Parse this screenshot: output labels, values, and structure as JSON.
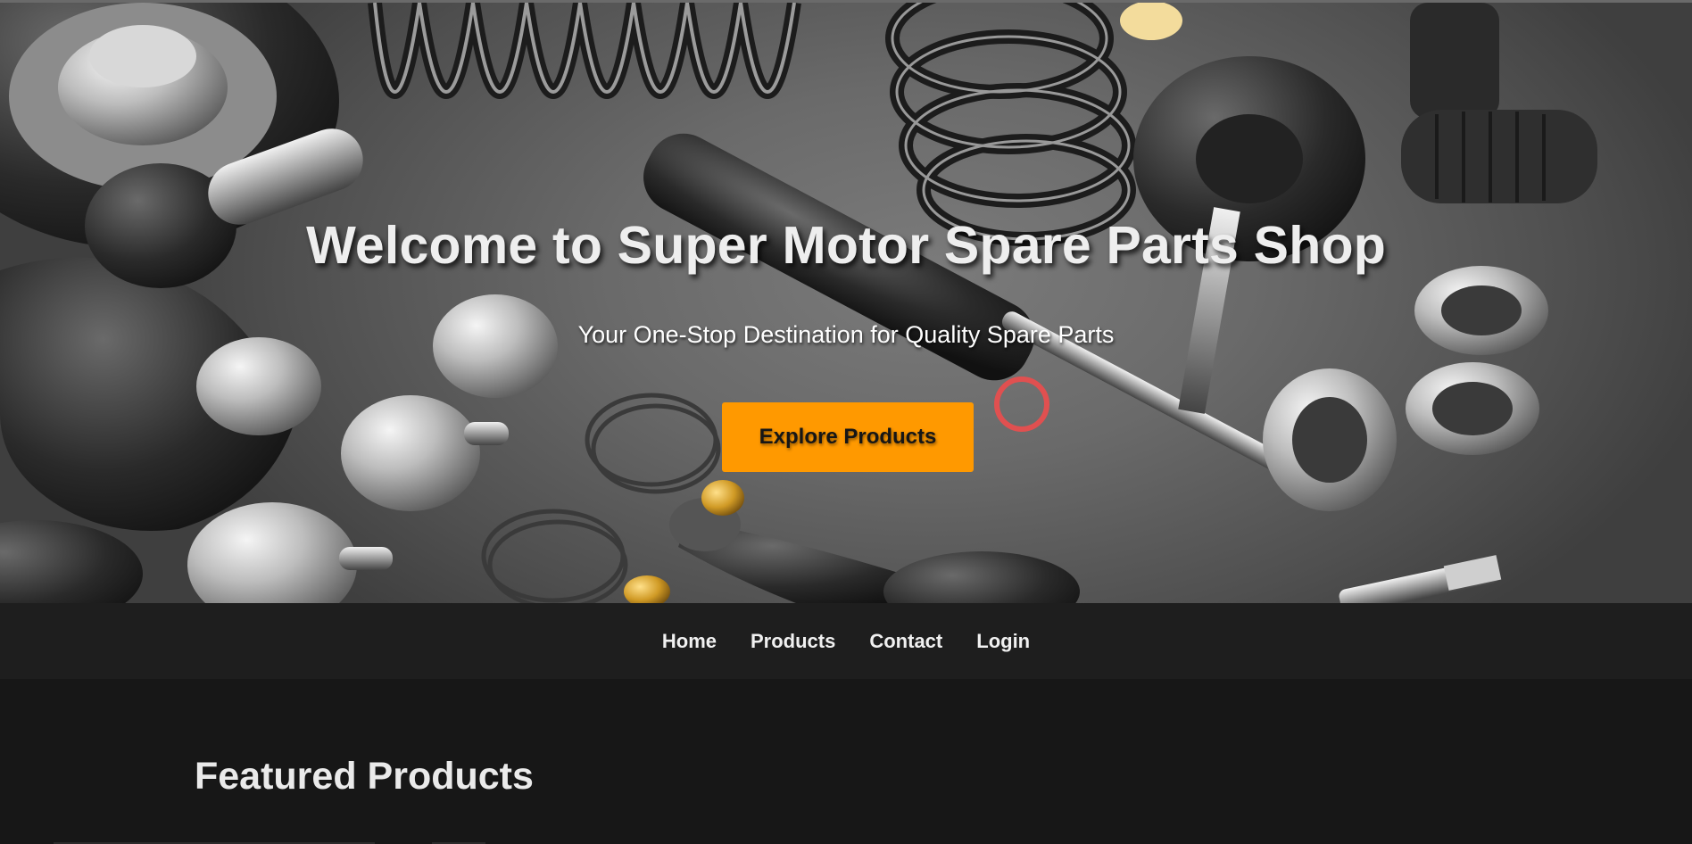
{
  "hero": {
    "title": "Welcome to Super Motor Spare Parts Shop",
    "subtitle": "Your One-Stop Destination for Quality Spare Parts",
    "cta_label": "Explore Products",
    "cta_color": "#ff9900"
  },
  "nav": {
    "items": [
      {
        "label": "Home"
      },
      {
        "label": "Products"
      },
      {
        "label": "Contact"
      },
      {
        "label": "Login"
      }
    ]
  },
  "featured": {
    "title": "Featured Products"
  },
  "colors": {
    "nav_bg": "#1e1e1e",
    "page_bg": "#171717",
    "accent": "#ff9900"
  }
}
